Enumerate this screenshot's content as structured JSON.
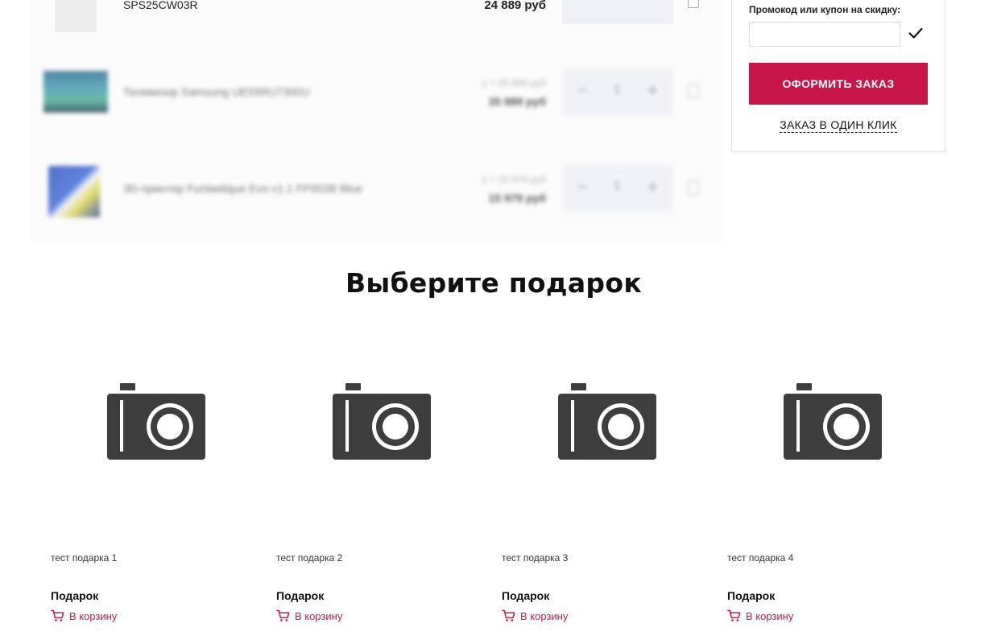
{
  "cart": {
    "items": [
      {
        "name": "SPS25CW03R",
        "price": "24 889 руб",
        "old_price": "",
        "qty": ""
      },
      {
        "name": "Телевизор Samsung UE55RU7300U",
        "old_price": "1 × 35 889 руб",
        "price": "35 889 руб",
        "qty": "1"
      },
      {
        "name": "3D-принтер Funtastique Evo v1.1 FP002B Blue",
        "old_price": "1 × 15 979 руб",
        "price": "15 979 руб",
        "qty": "1"
      }
    ],
    "qty_minus": "−",
    "qty_plus": "+"
  },
  "summary": {
    "promo_label": "Промокод или купон на скидку:",
    "promo_value": "",
    "order_button": "ОФОРМИТЬ ЗАКАЗ",
    "one_click": "ЗАКАЗ В ОДИН КЛИК"
  },
  "gifts": {
    "title": "Выберите подарок",
    "items": [
      {
        "name": "тест подарка 1",
        "price": "Подарок",
        "cart_label": "В корзину"
      },
      {
        "name": "тест подарка 2",
        "price": "Подарок",
        "cart_label": "В корзину"
      },
      {
        "name": "тест подарка 3",
        "price": "Подарок",
        "cart_label": "В корзину"
      },
      {
        "name": "тест подарка 4",
        "price": "Подарок",
        "cart_label": "В корзину"
      }
    ]
  },
  "colors": {
    "accent": "#c8154a",
    "placeholder_icon": "#3e3e3e"
  },
  "icons": {
    "product_placeholder": "camera-icon",
    "add_to_cart": "cart-icon",
    "apply_promo": "check-icon",
    "remove_item": "trash-icon"
  }
}
